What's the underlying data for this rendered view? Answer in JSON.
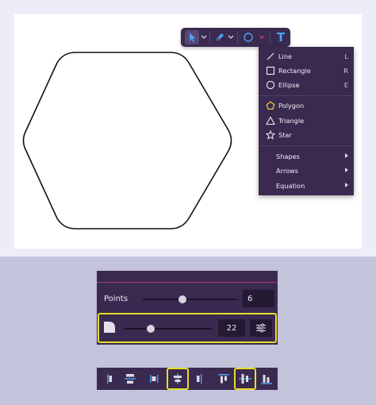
{
  "toolbar": {
    "tools": [
      "pointer-tool",
      "pen-tool",
      "ellipse-tool",
      "text-tool"
    ],
    "text_tool_glyph": "T"
  },
  "shape_menu": {
    "items": [
      {
        "label": "Line",
        "shortcut": "L",
        "icon": "line-icon"
      },
      {
        "label": "Rectangle",
        "shortcut": "R",
        "icon": "rectangle-icon"
      },
      {
        "label": "Ellipse",
        "shortcut": "E",
        "icon": "ellipse-icon"
      },
      {
        "label": "Polygon",
        "shortcut": "",
        "icon": "polygon-icon",
        "selected": true
      },
      {
        "label": "Triangle",
        "shortcut": "",
        "icon": "triangle-icon"
      },
      {
        "label": "Star",
        "shortcut": "",
        "icon": "star-icon"
      },
      {
        "label": "Shapes",
        "submenu": true
      },
      {
        "label": "Arrows",
        "submenu": true
      },
      {
        "label": "Equation",
        "submenu": true
      }
    ]
  },
  "points_panel": {
    "points_label": "Points",
    "points_value": "6",
    "points_slider_fraction": 0.42,
    "corner_radius_value": "22",
    "corner_slider_fraction": 0.3
  },
  "align_bar": {
    "buttons": [
      "align-left",
      "align-center-h",
      "align-right-edge",
      "distribute-h",
      "align-right",
      "align-top",
      "align-middle-v",
      "align-bottom"
    ],
    "highlighted": [
      "distribute-h",
      "align-middle-v"
    ]
  },
  "colors": {
    "panel_bg": "#3a2a50",
    "accent_blue": "#4aa3f0",
    "accent_pink": "#d2327a",
    "highlight_yellow": "#e8dd2a",
    "polygon_icon": "#f0c430"
  }
}
